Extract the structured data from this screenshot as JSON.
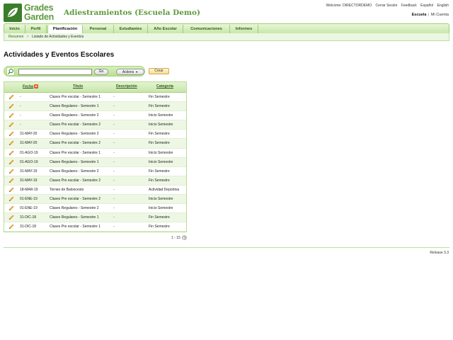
{
  "header": {
    "logo_line1": "Grades",
    "logo_line2": "Garden",
    "app_title": "Adiestramientos (Escuela Demo)",
    "welcome": "Welcome: DIRECTORDEMO",
    "logout": "Cerrar Sesión",
    "feedback": "Feedback",
    "lang_es": "Español",
    "lang_en": "English",
    "context_current": "Escuela",
    "context_sep": "|",
    "context_other": "Mi Cuenta"
  },
  "nav": {
    "tabs": [
      {
        "label": "Inicio"
      },
      {
        "label": "Perfil"
      },
      {
        "label": "Planificación"
      },
      {
        "label": "Personal"
      },
      {
        "label": "Estudiantes"
      },
      {
        "label": "Año Escolar"
      },
      {
        "label": "Comunicaciones"
      },
      {
        "label": "Informes"
      }
    ],
    "active_tab": "Planificación"
  },
  "breadcrumb": {
    "root": "Resumen",
    "sep": ">",
    "current": "Listado de Actividades y Eventos"
  },
  "page_title": "Actividades y Eventos Escolares",
  "toolbar": {
    "search_value": "",
    "go_label": "Go",
    "actions_label": "Actions",
    "create_label": "Crear"
  },
  "table": {
    "columns": [
      "Fecha",
      "Título",
      "Descripción",
      "Categoría"
    ],
    "sorted_column": "Fecha",
    "rows": [
      {
        "fecha": "-",
        "titulo": "Clases Pre escolar - Semestre 1",
        "descripcion": "-",
        "categoria": "Fin Semestre"
      },
      {
        "fecha": "-",
        "titulo": "Clases Regulares - Semestre 1",
        "descripcion": "-",
        "categoria": "Fin Semestre"
      },
      {
        "fecha": "-",
        "titulo": "Clases Regulares - Semestre 2",
        "descripcion": "-",
        "categoria": "Inicio Semestre"
      },
      {
        "fecha": "-",
        "titulo": "Clases Pre escolar - Semestre 2",
        "descripcion": "-",
        "categoria": "Inicio Semestre"
      },
      {
        "fecha": "31-MAY-20",
        "titulo": "Clases Regulares - Semestre 2",
        "descripcion": "-",
        "categoria": "Fin Semestre"
      },
      {
        "fecha": "31-MAY-20",
        "titulo": "Clases Pre escolar - Semestre 2",
        "descripcion": "-",
        "categoria": "Fin Semestre"
      },
      {
        "fecha": "01-AGO-19",
        "titulo": "Clases Pre escolar - Semestre 1",
        "descripcion": "-",
        "categoria": "Inicio Semestre"
      },
      {
        "fecha": "01-AGO-19",
        "titulo": "Clases Regulares - Semestre 1",
        "descripcion": "-",
        "categoria": "Inicio Semestre"
      },
      {
        "fecha": "31-MAY-19",
        "titulo": "Clases Regulares - Semestre 2",
        "descripcion": "-",
        "categoria": "Fin Semestre"
      },
      {
        "fecha": "31-MAY-19",
        "titulo": "Clases Pre escolar - Semestre 2",
        "descripcion": "-",
        "categoria": "Fin Semestre"
      },
      {
        "fecha": "18-MAR-19",
        "titulo": "Torneo de Baloncesto",
        "descripcion": "-",
        "categoria": "Actividad Deportiva"
      },
      {
        "fecha": "01-ENE-19",
        "titulo": "Clases Pre escolar - Semestre 2",
        "descripcion": "-",
        "categoria": "Inicio Semestre"
      },
      {
        "fecha": "01-ENE-19",
        "titulo": "Clases Regulares - Semestre 2",
        "descripcion": "-",
        "categoria": "Inicio Semestre"
      },
      {
        "fecha": "31-DIC-18",
        "titulo": "Clases Regulares - Semestre 1",
        "descripcion": "-",
        "categoria": "Fin Semestre"
      },
      {
        "fecha": "31-DIC-18",
        "titulo": "Clases Pre escolar - Semestre 1",
        "descripcion": "-",
        "categoria": "Fin Semestre"
      }
    ]
  },
  "pagination": {
    "range": "1 - 15"
  },
  "footer": {
    "release": "Release 3.3"
  },
  "icons": {
    "edit": "pencil-icon",
    "search": "magnifier-icon",
    "sort": "sort-desc-icon",
    "next": "next-page-icon"
  },
  "colors": {
    "brand_green": "#5c9a3c",
    "logo_bg": "#3a7d2a",
    "nav_border": "#9fcd75",
    "row_alt": "#eef7e4",
    "sort_orange": "#e2602a"
  }
}
